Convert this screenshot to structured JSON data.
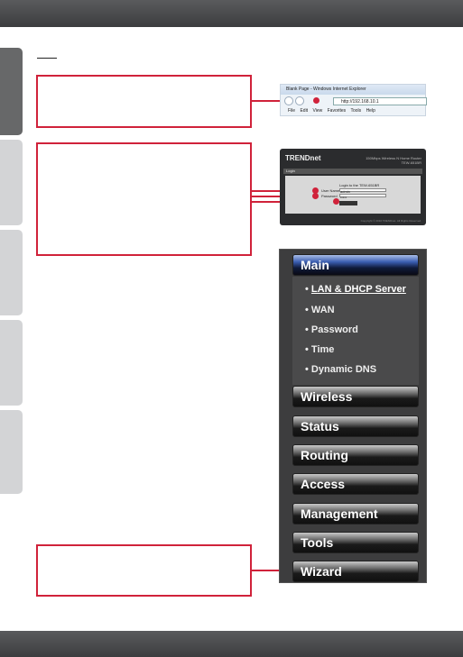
{
  "browser": {
    "title": "Blank Page - Windows Internet Explorer",
    "address": "http://192.168.10.1",
    "menu": [
      "File",
      "Edit",
      "View",
      "Favorites",
      "Tools",
      "Help"
    ]
  },
  "login": {
    "brand": "TRENDnet",
    "model": "150Mbps Wireless N Home Router TEW-651BR",
    "section": "Login",
    "prompt": "Login to the TEW-651BR",
    "user_label": "User Name",
    "user_value": "admin",
    "pass_label": "Password",
    "pass_value": "•••••",
    "copyright": "Copyright © 2010 TRENDnet. All Rights Reserved."
  },
  "menu": {
    "main": "Main",
    "sub": [
      "LAN & DHCP Server",
      "WAN",
      "Password",
      "Time",
      "Dynamic DNS"
    ],
    "items": [
      "Wireless",
      "Status",
      "Routing",
      "Access",
      "Management",
      "Tools",
      "Wizard"
    ]
  },
  "colors": {
    "accent": "#d0223a",
    "bar": "#4a4b4d"
  }
}
